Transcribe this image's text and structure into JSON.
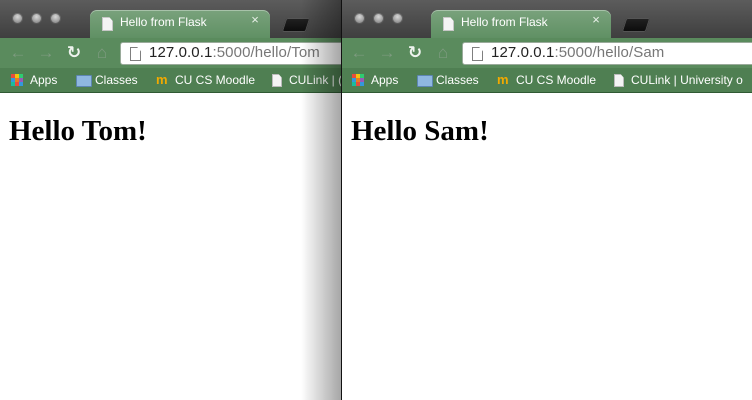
{
  "colors": {
    "tab_active": "#6b9a6e",
    "toolbar": "#5a8b5d",
    "bookmarks_bar": "#4f7f52",
    "tabstrip": "#4c4c4c"
  },
  "windows": [
    {
      "tab": {
        "title": "Hello from Flask",
        "close": "×"
      },
      "nav": {
        "back": "←",
        "forward": "→",
        "reload": "↻",
        "home": "⌂"
      },
      "address": {
        "host": "127.0.0.1",
        "path": ":5000/hello/Tom"
      },
      "bookmarks": [
        {
          "label": "Apps",
          "icon": "apps-icon"
        },
        {
          "label": "Classes",
          "icon": "folder-icon"
        },
        {
          "label": "CU CS Moodle",
          "icon": "moodle-icon"
        },
        {
          "label": "CULink | (",
          "icon": "page-icon"
        }
      ],
      "heading": "Hello Tom!"
    },
    {
      "tab": {
        "title": "Hello from Flask",
        "close": "×"
      },
      "nav": {
        "back": "←",
        "forward": "→",
        "reload": "↻",
        "home": "⌂"
      },
      "address": {
        "host": "127.0.0.1",
        "path": ":5000/hello/Sam"
      },
      "bookmarks": [
        {
          "label": "Apps",
          "icon": "apps-icon"
        },
        {
          "label": "Classes",
          "icon": "folder-icon"
        },
        {
          "label": "CU CS Moodle",
          "icon": "moodle-icon"
        },
        {
          "label": "CULink | University o",
          "icon": "page-icon"
        }
      ],
      "heading": "Hello Sam!"
    }
  ]
}
